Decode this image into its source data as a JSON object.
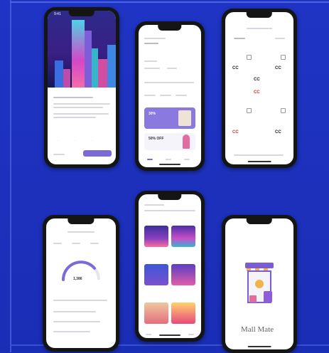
{
  "phones": {
    "p1": {
      "time": "9:41"
    },
    "p2": {
      "promo1": "30%",
      "promo2": "50% OFF"
    },
    "p4": {
      "value": "1,386"
    },
    "p6": {
      "brand": "Mall Mate"
    }
  },
  "colors": {
    "board": "#1b2fb9",
    "accent": "#7b6bd6",
    "phone": "#151515"
  }
}
